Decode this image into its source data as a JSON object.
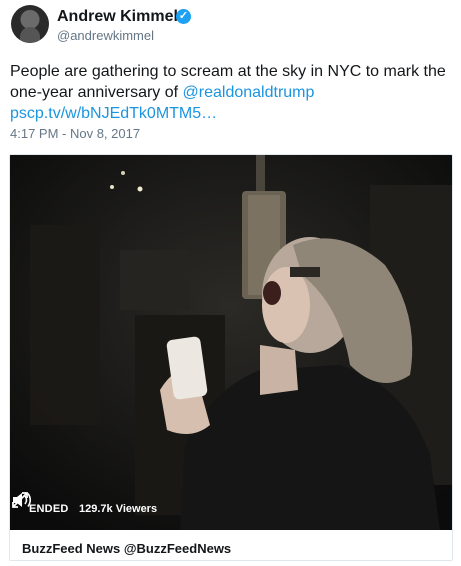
{
  "author": {
    "name": "Andrew Kimmel",
    "verified_icon": "verified-badge-icon",
    "handle": "@andrewkimmel"
  },
  "tweet": {
    "text_before": "People are gathering to scream at the sky in NYC to mark the one-year anniversary of ",
    "mention": "@realdonaldtrump",
    "link": "pscp.tv/w/bNJEdTk0MTM5…",
    "timestamp": "4:17 PM - Nov 8, 2017"
  },
  "video": {
    "status": "ENDED",
    "viewers": "129.7k Viewers",
    "volume_icon": "volume-icon",
    "fullscreen_icon": "fullscreen-icon"
  },
  "card": {
    "source": "BuzzFeed News @BuzzFeedNews"
  },
  "colors": {
    "link": "#1b95e0",
    "verified": "#1da1f2",
    "secondary_text": "#657786"
  }
}
